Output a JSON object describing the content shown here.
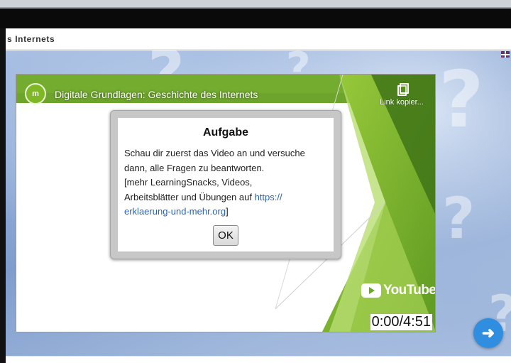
{
  "window": {
    "title_fragment": "s Internets"
  },
  "video": {
    "title": "Digitale Grundlagen: Geschichte des Internets",
    "channel_logo_text": "m",
    "copy_link_label": "Link kopier...",
    "brand": "YouTube",
    "time": "0:00/4:51"
  },
  "dialog": {
    "title": "Aufgabe",
    "line1": "Schau dir zuerst das Video an und versuche",
    "line2": "dann, alle Fragen zu beantworten.",
    "line3": "[mehr LearningSnacks, Videos,",
    "line4_text": "Arbeitsblätter und Übungen auf ",
    "link_part1": "https://",
    "link_part2": "erklaerung-und-mehr.org",
    "bracket_close": "]",
    "ok_label": "OK"
  },
  "nav": {
    "next_arrow": "➜"
  },
  "colors": {
    "green": "#7fb827",
    "accent_blue": "#2f8ee0",
    "link": "#2a62b8"
  }
}
